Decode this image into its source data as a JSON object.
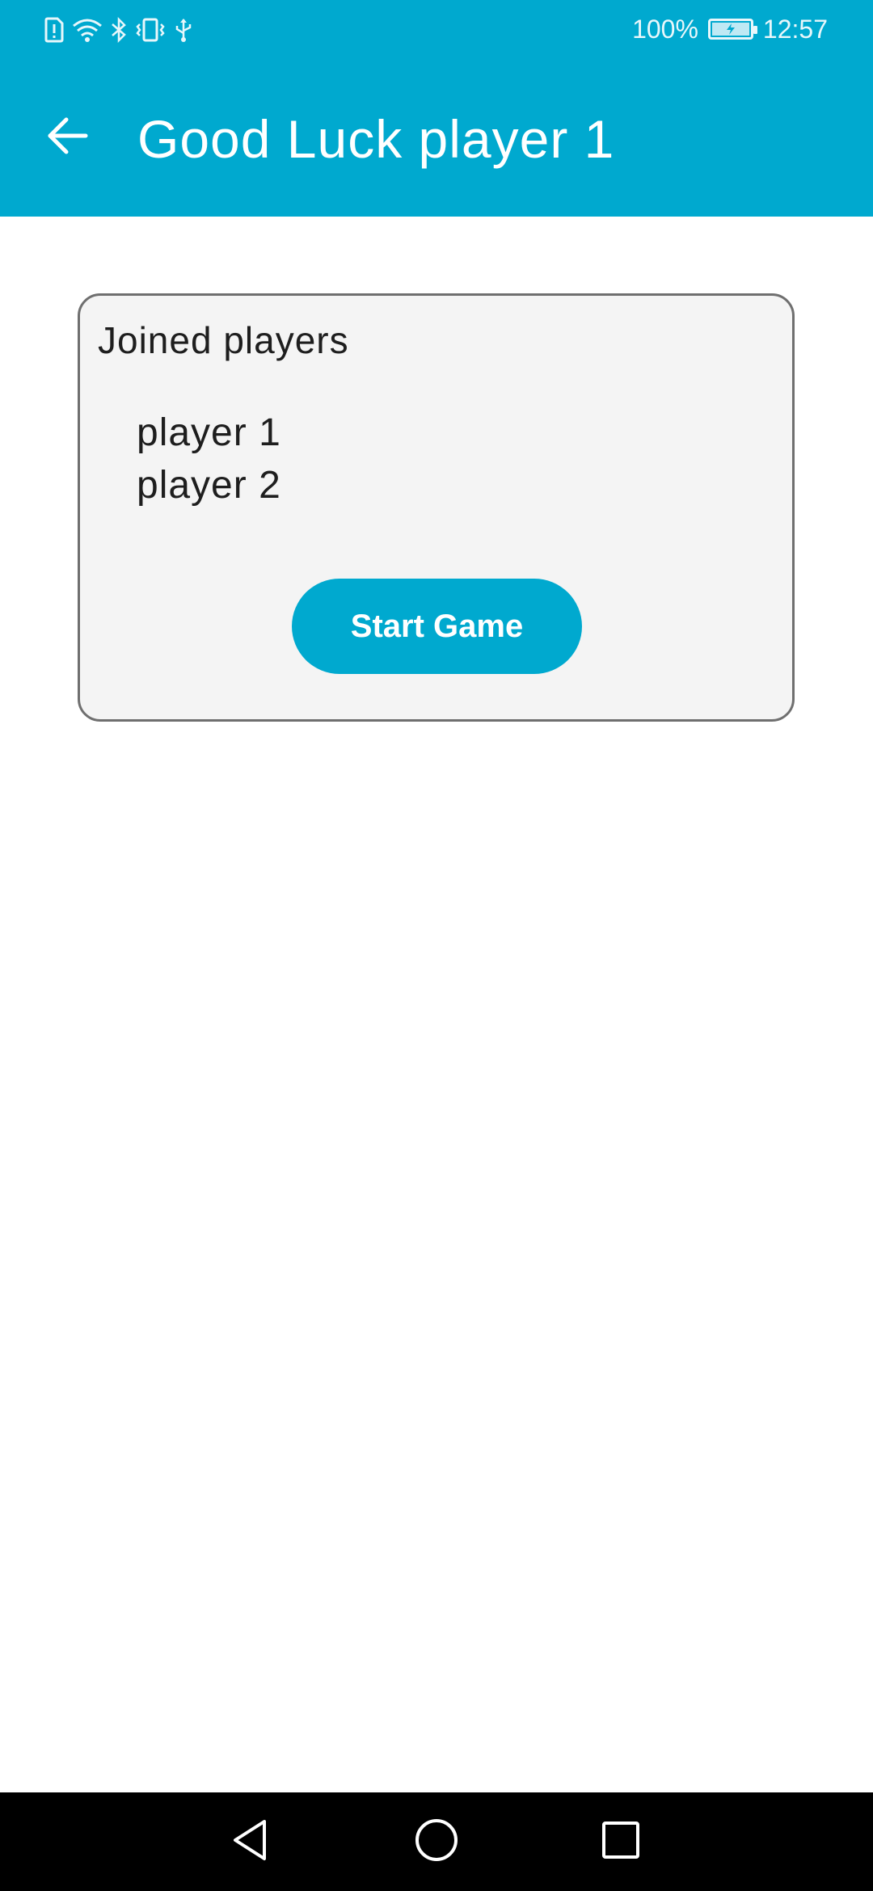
{
  "status_bar": {
    "icons": [
      "alert-icon",
      "wifi-icon",
      "bluetooth-icon",
      "vibrate-icon",
      "usb-icon"
    ],
    "battery_percent": "100%",
    "battery_icon": "battery-charging-icon",
    "time": "12:57"
  },
  "app_bar": {
    "back_icon": "arrow-back-icon",
    "title": "Good Luck player 1"
  },
  "card": {
    "title": "Joined players",
    "players": [
      "player 1",
      "player 2"
    ],
    "start_label": "Start Game"
  },
  "nav_bar": {
    "buttons": [
      "back-triangle-icon",
      "home-circle-icon",
      "recents-square-icon"
    ]
  },
  "colors": {
    "accent": "#00a9cf",
    "card_background": "#f4f4f4",
    "card_border": "#6f6f6f",
    "text": "#1e1e1e",
    "nav_bar": "#000000"
  }
}
